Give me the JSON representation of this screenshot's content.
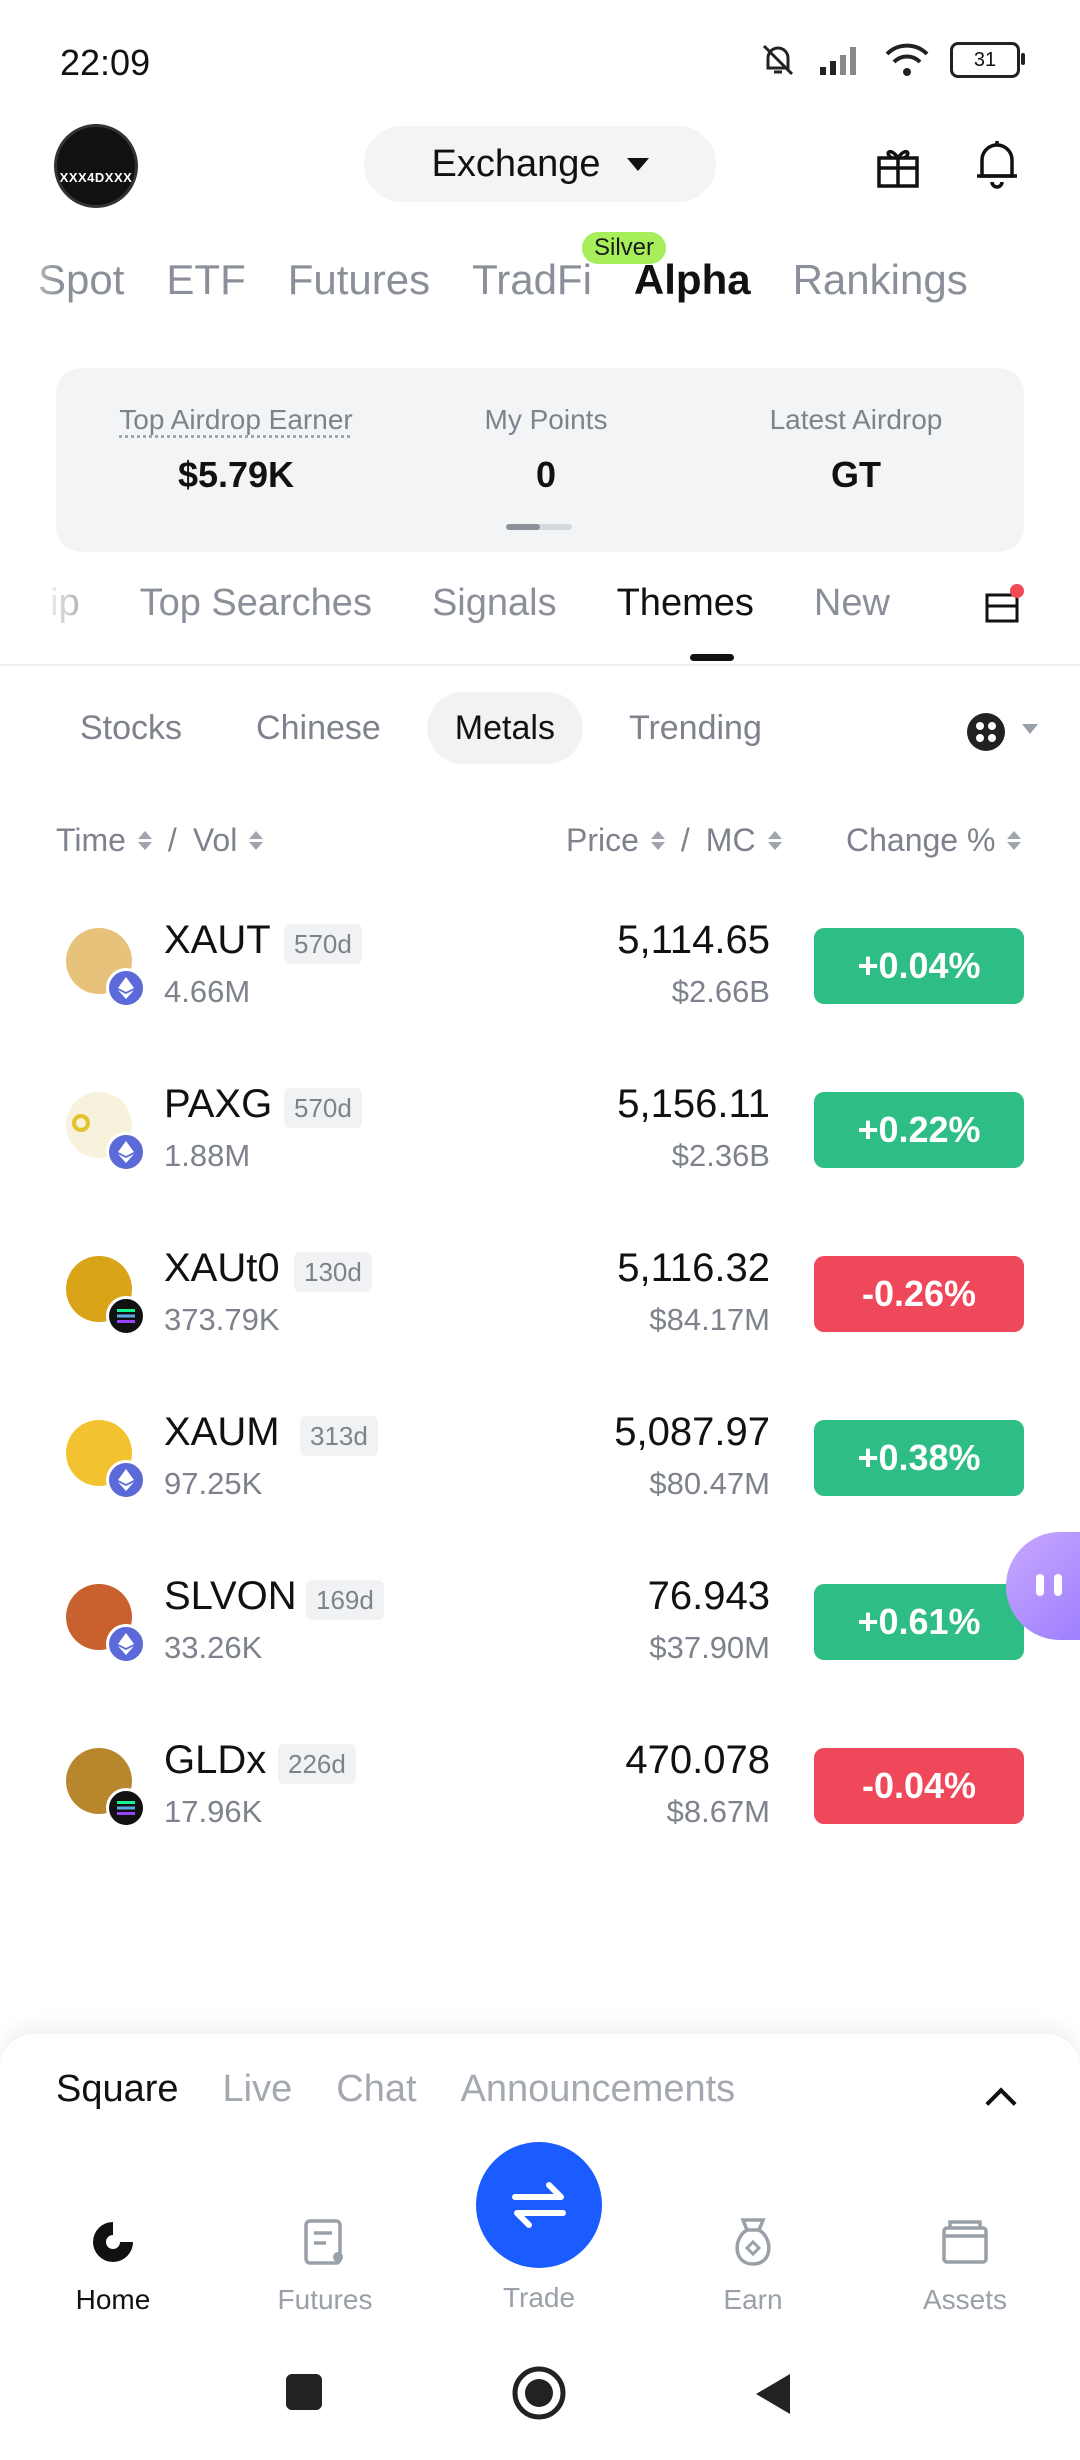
{
  "status_bar": {
    "time": "22:09",
    "battery": "31"
  },
  "header": {
    "avatar_text": "XXX4DXXX",
    "mode_label": "Exchange"
  },
  "main_tabs": [
    {
      "label": "Spot",
      "active": false
    },
    {
      "label": "ETF",
      "active": false
    },
    {
      "label": "Futures",
      "active": false
    },
    {
      "label": "TradFi",
      "active": false
    },
    {
      "label": "Alpha",
      "active": true
    },
    {
      "label": "Rankings",
      "active": false
    }
  ],
  "tradfi_badge": "Silver",
  "stats": {
    "top_airdrop_label": "Top Airdrop Earner",
    "top_airdrop_value": "$5.79K",
    "points_label": "My Points",
    "points_value": "0",
    "latest_label": "Latest Airdrop",
    "latest_value": "GT"
  },
  "sub_tabs": [
    {
      "label": "ip",
      "active": false
    },
    {
      "label": "Top Searches",
      "active": false
    },
    {
      "label": "Signals",
      "active": false
    },
    {
      "label": "Themes",
      "active": true
    },
    {
      "label": "New",
      "active": false
    }
  ],
  "chips": [
    {
      "label": "Stocks",
      "active": false
    },
    {
      "label": "Chinese",
      "active": false
    },
    {
      "label": "Metals",
      "active": true
    },
    {
      "label": "Trending",
      "active": false
    }
  ],
  "columns": {
    "time": "Time",
    "vol": "Vol",
    "price": "Price",
    "mc": "MC",
    "change": "Change %",
    "sep": "/"
  },
  "tokens": [
    {
      "symbol": "XAUT",
      "age": "570d",
      "vol": "4.66M",
      "price": "5,114.65",
      "mc": "$2.66B",
      "change": "+0.04%",
      "direction": "up",
      "chain": "ethereum",
      "icon_color": "#e6c27a"
    },
    {
      "symbol": "PAXG",
      "age": "570d",
      "vol": "1.88M",
      "price": "5,156.11",
      "mc": "$2.36B",
      "change": "+0.22%",
      "direction": "up",
      "chain": "ethereum",
      "icon_color": "#f7f2dc"
    },
    {
      "symbol": "XAUt0",
      "age": "130d",
      "vol": "373.79K",
      "price": "5,116.32",
      "mc": "$84.17M",
      "change": "-0.26%",
      "direction": "down",
      "chain": "solana",
      "icon_color": "#d9a418"
    },
    {
      "symbol": "XAUM",
      "age": "313d",
      "vol": "97.25K",
      "price": "5,087.97",
      "mc": "$80.47M",
      "change": "+0.38%",
      "direction": "up",
      "chain": "ethereum",
      "icon_color": "#f2c230"
    },
    {
      "symbol": "SLVON",
      "age": "169d",
      "vol": "33.26K",
      "price": "76.943",
      "mc": "$37.90M",
      "change": "+0.61%",
      "direction": "up",
      "chain": "ethereum",
      "icon_color": "#c9612e"
    },
    {
      "symbol": "GLDx",
      "age": "226d",
      "vol": "17.96K",
      "price": "470.078",
      "mc": "$8.67M",
      "change": "-0.04%",
      "direction": "down",
      "chain": "solana",
      "icon_color": "#b8862d"
    }
  ],
  "feed_tabs": [
    {
      "label": "Square",
      "active": true
    },
    {
      "label": "Live",
      "active": false
    },
    {
      "label": "Chat",
      "active": false
    },
    {
      "label": "Announcements",
      "active": false
    }
  ],
  "bottom_nav": {
    "home": "Home",
    "futures": "Futures",
    "trade": "Trade",
    "earn": "Earn",
    "assets": "Assets"
  },
  "colors": {
    "up": "#2ebd85",
    "down": "#f0485b",
    "accent": "#1a5cff"
  }
}
